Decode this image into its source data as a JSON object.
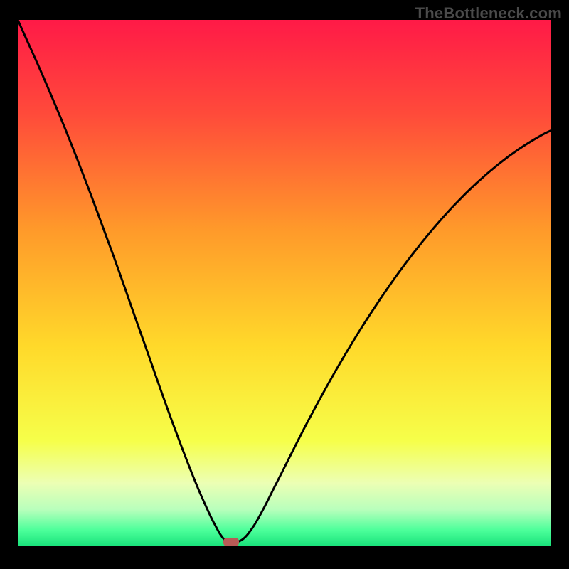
{
  "watermark": "TheBottleneck.com",
  "chart_data": {
    "type": "line",
    "title": "",
    "xlabel": "",
    "ylabel": "",
    "xlim": [
      0,
      100
    ],
    "ylim": [
      0,
      100
    ],
    "grid": false,
    "series": [
      {
        "name": "curve",
        "x": [
          0,
          2,
          4,
          6,
          8,
          10,
          12,
          14,
          16,
          18,
          20,
          22,
          24,
          26,
          28,
          30,
          32,
          34,
          36,
          37,
          38,
          39,
          40,
          42,
          44,
          46,
          48,
          50,
          54,
          58,
          62,
          66,
          70,
          74,
          78,
          82,
          86,
          90,
          94,
          98,
          100
        ],
        "y": [
          100,
          95.5,
          91,
          86.3,
          81.5,
          76.5,
          71.3,
          66,
          60.5,
          55,
          49.3,
          43.5,
          37.8,
          32,
          26.3,
          20.8,
          15.5,
          10.5,
          6,
          4,
          2.2,
          1,
          0.8,
          1.2,
          3.5,
          7,
          11,
          15,
          23,
          30.5,
          37.5,
          44,
          50,
          55.5,
          60.5,
          65,
          69,
          72.5,
          75.5,
          78,
          79
        ]
      }
    ],
    "marker": {
      "x": 40,
      "y": 0.8
    },
    "gradient_stops": [
      {
        "offset": 0,
        "color": "#ff1a47"
      },
      {
        "offset": 18,
        "color": "#ff4b3a"
      },
      {
        "offset": 40,
        "color": "#ff9a2a"
      },
      {
        "offset": 62,
        "color": "#ffd92a"
      },
      {
        "offset": 80,
        "color": "#f6ff4a"
      },
      {
        "offset": 88,
        "color": "#ecffb4"
      },
      {
        "offset": 93,
        "color": "#b9ffbc"
      },
      {
        "offset": 97,
        "color": "#4bff9a"
      },
      {
        "offset": 100,
        "color": "#18e27a"
      }
    ],
    "marker_color": "#b85a56"
  }
}
